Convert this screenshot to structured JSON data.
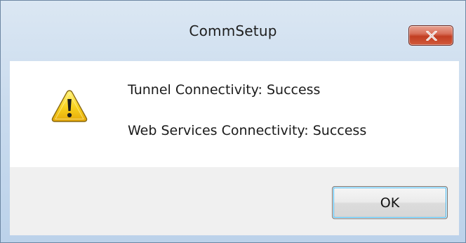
{
  "window": {
    "title": "CommSetup"
  },
  "icons": {
    "close": "close-icon",
    "message": "warning-icon"
  },
  "messages": [
    "Tunnel Connectivity: Success",
    "Web Services Connectivity: Success"
  ],
  "buttons": {
    "ok_label": "OK"
  },
  "colors": {
    "close_button": "#c23e22",
    "ok_focus_ring": "#3fb8f2",
    "warning_yellow": "#f7d11c"
  }
}
